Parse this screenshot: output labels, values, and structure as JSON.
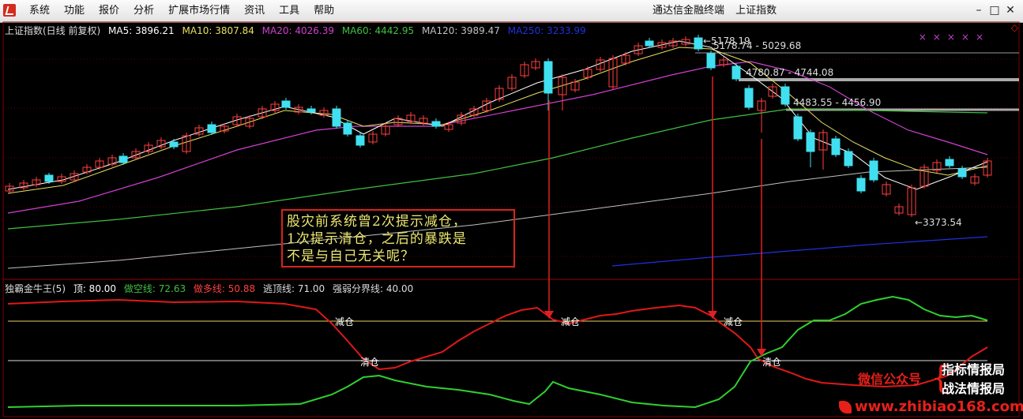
{
  "app": {
    "menu": [
      "系统",
      "功能",
      "报价",
      "分析",
      "扩展市场行情",
      "资讯",
      "工具",
      "帮助"
    ],
    "title_app": "通达信金融终端",
    "title_doc": "上证指数"
  },
  "main_info": {
    "name": "上证指数(日线 前复权)",
    "ma5": "MA5: 3896.21",
    "ma10": "MA10: 3807.84",
    "ma20": "MA20: 4026.39",
    "ma60": "MA60: 4442.95",
    "ma120": "MA120: 3989.47",
    "ma250": "MA250: 3233.99"
  },
  "price_labels": {
    "high": "5178.19",
    "zone1": "5178.74 - 5029.68",
    "zone2": "4780.87 - 4744.08",
    "zone3": "4483.55 - 4456.90",
    "low": "3373.54"
  },
  "indicator_info": {
    "name": "独霸金牛王(5)",
    "top": "顶: 80.00",
    "bear": "做空线: 72.63",
    "bull": "做多线: 50.88",
    "escape": "逃顶线: 71.00",
    "divide": "强弱分界线: 40.00"
  },
  "signals": [
    "减仓",
    "清仓",
    "减仓",
    "减仓",
    "清仓"
  ],
  "annotation": {
    "line1": "股灾前系统曾2次提示减仓，",
    "line2": "1次提示清仓，之后的暴跌是",
    "line3": "不是与自己无关呢？"
  },
  "watermark": {
    "wechat": "微信公众号",
    "name1": "指标情报局",
    "name2": "战法情报局",
    "url": "www.zhibiao168.com"
  },
  "colors": {
    "ma5": "#ffffff",
    "ma10": "#e8e060",
    "ma20": "#d040d0",
    "ma60": "#40c040",
    "ma120": "#c0c0c0",
    "ma250": "#2030e0",
    "up": "#ff4040",
    "down": "#40e0f0"
  },
  "chart_data": {
    "type": "candlestick",
    "ma_values": {
      "MA5": 3896.21,
      "MA10": 3807.84,
      "MA20": 4026.39,
      "MA60": 4442.95,
      "MA120": 3989.47,
      "MA250": 3233.99
    },
    "marked_prices": [
      5178.19,
      5029.68,
      4780.87,
      4744.08,
      4483.55,
      4456.9,
      3373.54
    ],
    "indicator_levels": {
      "top": 80.0,
      "bear_line": 72.63,
      "bull_line": 50.88,
      "escape_line": 71.0,
      "divide_line": 40.0
    }
  }
}
